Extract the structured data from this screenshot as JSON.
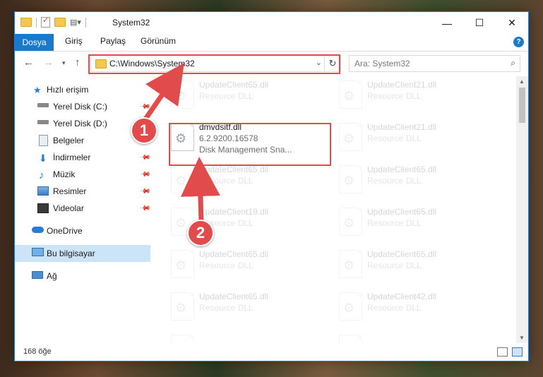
{
  "window": {
    "title": "System32",
    "controls": {
      "minimize": "—",
      "maximize": "☐",
      "close": "✕"
    }
  },
  "ribbon": {
    "tabs": [
      "Dosya",
      "Giriş",
      "Paylaş",
      "Görünüm"
    ],
    "help": "?"
  },
  "nav": {
    "address": "C:\\Windows\\System32",
    "search_placeholder": "Ara: System32",
    "icons": {
      "back": "arrow-left-icon",
      "forward": "arrow-right-icon",
      "recent": "chevron-down-icon",
      "up": "arrow-up-icon",
      "refresh": "refresh-icon",
      "search": "search-icon"
    }
  },
  "sidebar": {
    "items": [
      {
        "label": "Hızlı erişim",
        "icon": "star-icon"
      },
      {
        "label": "Yerel Disk (C:)",
        "icon": "drive-icon"
      },
      {
        "label": "Yerel Disk (D:)",
        "icon": "drive-icon"
      },
      {
        "label": "Belgeler",
        "icon": "documents-icon"
      },
      {
        "label": "İndirmeler",
        "icon": "download-icon"
      },
      {
        "label": "Müzik",
        "icon": "music-icon"
      },
      {
        "label": "Resimler",
        "icon": "pictures-icon"
      },
      {
        "label": "Videolar",
        "icon": "video-icon"
      },
      {
        "label": "OneDrive",
        "icon": "cloud-icon"
      },
      {
        "label": "Bu bilgisayar",
        "icon": "computer-icon"
      },
      {
        "label": "Ağ",
        "icon": "network-icon"
      }
    ],
    "selected": "Bu bilgisayar"
  },
  "files": {
    "highlighted": {
      "name": "dmvdsitf.dll",
      "version": "6.2.9200.16578",
      "description": "Disk Management Sna..."
    },
    "left_column": [
      {
        "name": "UpdateClient65.dll",
        "type": "Resource DLL"
      },
      {
        "name": "UpdateClient65.dll",
        "type": "Resource DLL"
      },
      {
        "name": "UpdateClient19.dll",
        "type": "Resource DLL"
      },
      {
        "name": "UpdateClient65.dll",
        "type": "Resource DLL"
      },
      {
        "name": "UpdateClient65.dll",
        "type": "Resource DLL"
      },
      {
        "name": "",
        "type": ""
      }
    ],
    "right_column": [
      {
        "name": "UpdateClient21.dll",
        "type": "Resource DLL"
      },
      {
        "name": "UpdateClient21.dll",
        "type": "Resource DLL"
      },
      {
        "name": "UpdateClient65.dll",
        "type": "Resource DLL"
      },
      {
        "name": "UpdateClient65.dll",
        "type": "Resource DLL"
      },
      {
        "name": "UpdateClient65.dll",
        "type": "Resource DLL"
      },
      {
        "name": "UpdateClient42.dll",
        "type": "Resource DLL"
      },
      {
        "name": "",
        "type": ""
      }
    ]
  },
  "status": {
    "count": "168 öğe"
  },
  "annotations": {
    "callout1": "1",
    "callout2": "2",
    "color": "#e14b4b"
  }
}
